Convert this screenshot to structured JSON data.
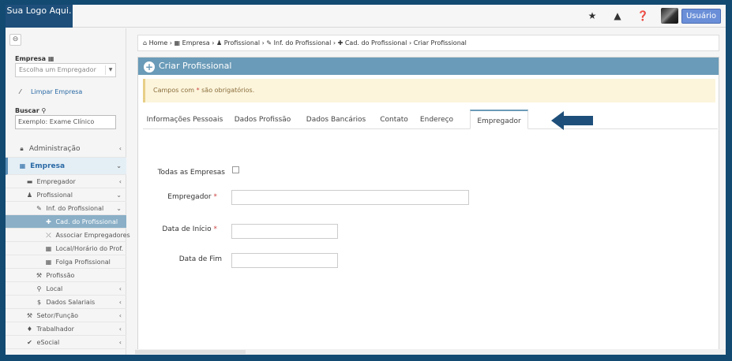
{
  "topbar": {
    "logo_text": "Sua Logo Aqui.",
    "icons": [
      "star-icon",
      "warning-icon",
      "help-icon"
    ],
    "user_label": "Usuário"
  },
  "sidebar": {
    "empresa_label": "Empresa",
    "empresa_select_placeholder": "Escolha um Empregador",
    "limpar_label": "Limpar Empresa",
    "buscar_label": "Buscar",
    "buscar_value": "Exemplo: Exame Clínico",
    "menu": [
      {
        "label": "Administração",
        "icon": "lock-icon"
      },
      {
        "label": "Empresa",
        "icon": "building-icon"
      },
      {
        "label": "Empregador",
        "icon": "briefcase-icon"
      },
      {
        "label": "Profissional",
        "icon": "user-icon"
      },
      {
        "label": "Inf. do Profissional",
        "icon": "pencil-icon"
      },
      {
        "label": "Cad. do Profissional",
        "icon": "plus-icon"
      },
      {
        "label": "Associar Empregadores",
        "icon": "link-icon"
      },
      {
        "label": "Local/Horário do Prof.",
        "icon": "calendar-icon"
      },
      {
        "label": "Folga Profissional",
        "icon": "calendar-icon"
      },
      {
        "label": "Profissão",
        "icon": "wrench-icon"
      },
      {
        "label": "Local",
        "icon": "map-marker-icon"
      },
      {
        "label": "Dados Salariais",
        "icon": "dollar-icon"
      },
      {
        "label": "Setor/Função",
        "icon": "tools-icon"
      },
      {
        "label": "Trabalhador",
        "icon": "person-icon"
      },
      {
        "label": "eSocial",
        "icon": "check-icon"
      }
    ]
  },
  "breadcrumb": {
    "items": [
      "Home",
      "Empresa",
      "Profissional",
      "Inf. do Profissional",
      "Cad. do Profissional",
      "Criar Profissional"
    ]
  },
  "panel": {
    "title": "Criar Profissional",
    "alert_prefix": "Campos com ",
    "alert_star": "*",
    "alert_suffix": " são obrigatórios."
  },
  "tabs": [
    {
      "label": "Informações Pessoais"
    },
    {
      "label": "Dados Profissão"
    },
    {
      "label": "Dados Bancários"
    },
    {
      "label": "Contato"
    },
    {
      "label": "Endereço"
    },
    {
      "label": "Empregador",
      "active": true
    }
  ],
  "form": {
    "todas_label": "Todas as Empresas",
    "empregador_label": "Empregador",
    "data_inicio_label": "Data de Início",
    "data_fim_label": "Data de Fim",
    "required_mark": "*"
  },
  "colors": {
    "brand": "#1e4f7a",
    "panel_header": "#6a9bb8",
    "active_menu": "#8aafc7",
    "arrow": "#1e4f7a"
  }
}
